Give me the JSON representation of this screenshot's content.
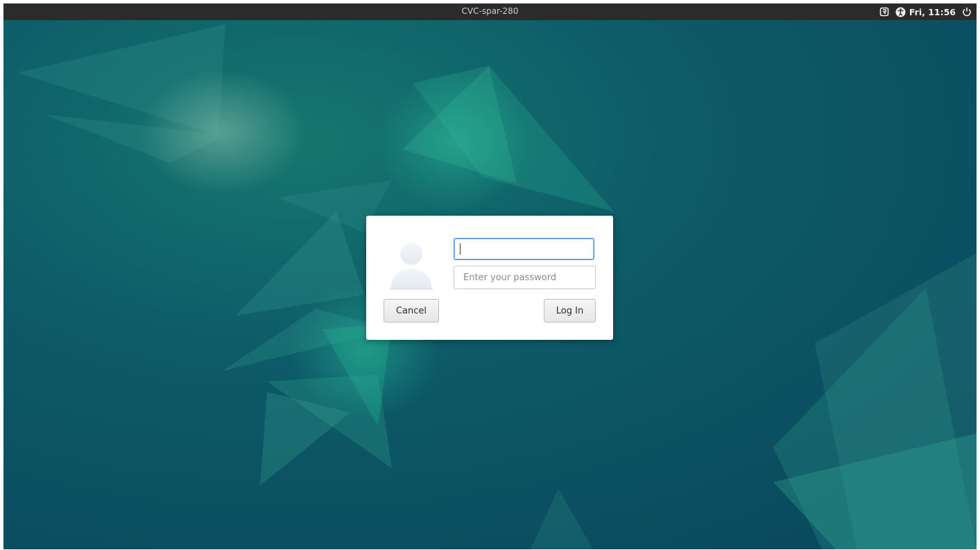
{
  "panel": {
    "hostname": "CVC-spar-280",
    "clock": "Fri, 11:56",
    "icons": [
      "screen-reader-icon",
      "accessibility-icon",
      "power-icon"
    ]
  },
  "login": {
    "username_value": "",
    "password_placeholder": "Enter your password",
    "cancel_label": "Cancel",
    "login_label": "Log In",
    "avatar_icon": "user-avatar-icon"
  },
  "colors": {
    "panel_bg": "#2b2b2b",
    "wallpaper_base": "#0b4e63",
    "wallpaper_accent": "#1e9a83",
    "focus_border": "#4a90d9"
  }
}
